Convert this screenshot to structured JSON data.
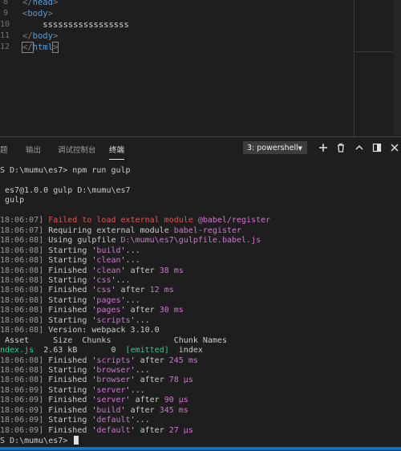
{
  "editor": {
    "lines": [
      {
        "num": "8",
        "indent": "",
        "kind": "close",
        "tag": "head"
      },
      {
        "num": "9",
        "indent": "",
        "kind": "open",
        "tag": "body"
      },
      {
        "num": "10",
        "indent": "    ",
        "kind": "text",
        "text": "sssssssssssssssss"
      },
      {
        "num": "11",
        "indent": "",
        "kind": "close",
        "tag": "body"
      },
      {
        "num": "12",
        "indent": "",
        "kind": "close-boxed",
        "tag": "html"
      }
    ]
  },
  "panel": {
    "tabs": [
      "题",
      "输出",
      "调试控制台",
      "终端"
    ],
    "active_tab": "终端",
    "terminal_select": "3: powershell"
  },
  "terminal": {
    "lines": [
      {
        "segs": [
          {
            "t": "S D:\\mumu\\es7> npm run gulp"
          }
        ]
      },
      {
        "segs": [
          {
            "t": ""
          }
        ]
      },
      {
        "segs": [
          {
            "t": " es7@1.0.0 gulp D:\\mumu\\es7"
          }
        ]
      },
      {
        "segs": [
          {
            "t": " gulp"
          }
        ]
      },
      {
        "segs": [
          {
            "t": ""
          }
        ]
      },
      {
        "segs": [
          {
            "t": "18:06:07]",
            "c": "ts"
          },
          {
            "t": " Failed to load external module ",
            "c": "red"
          },
          {
            "t": "@babel/register",
            "c": "mag"
          }
        ]
      },
      {
        "segs": [
          {
            "t": "18:06:07]",
            "c": "ts"
          },
          {
            "t": " Requiring external module "
          },
          {
            "t": "babel-register",
            "c": "mag"
          }
        ]
      },
      {
        "segs": [
          {
            "t": "18:06:08]",
            "c": "ts"
          },
          {
            "t": " Using gulpfile "
          },
          {
            "t": "D:\\mumu\\es7\\gulpfile.babel.js",
            "c": "mag"
          }
        ]
      },
      {
        "segs": [
          {
            "t": "18:06:08]",
            "c": "ts"
          },
          {
            "t": " Starting '"
          },
          {
            "t": "build",
            "c": "mag"
          },
          {
            "t": "'..."
          }
        ]
      },
      {
        "segs": [
          {
            "t": "18:06:08]",
            "c": "ts"
          },
          {
            "t": " Starting '"
          },
          {
            "t": "clean",
            "c": "mag"
          },
          {
            "t": "'..."
          }
        ]
      },
      {
        "segs": [
          {
            "t": "18:06:08]",
            "c": "ts"
          },
          {
            "t": " Finished '"
          },
          {
            "t": "clean",
            "c": "mag"
          },
          {
            "t": "' after "
          },
          {
            "t": "38 ms",
            "c": "mag"
          }
        ]
      },
      {
        "segs": [
          {
            "t": "18:06:08]",
            "c": "ts"
          },
          {
            "t": " Starting '"
          },
          {
            "t": "css",
            "c": "mag"
          },
          {
            "t": "'..."
          }
        ]
      },
      {
        "segs": [
          {
            "t": "18:06:08]",
            "c": "ts"
          },
          {
            "t": " Finished '"
          },
          {
            "t": "css",
            "c": "mag"
          },
          {
            "t": "' after "
          },
          {
            "t": "12 ms",
            "c": "mag"
          }
        ]
      },
      {
        "segs": [
          {
            "t": "18:06:08]",
            "c": "ts"
          },
          {
            "t": " Starting '"
          },
          {
            "t": "pages",
            "c": "mag"
          },
          {
            "t": "'..."
          }
        ]
      },
      {
        "segs": [
          {
            "t": "18:06:08]",
            "c": "ts"
          },
          {
            "t": " Finished '"
          },
          {
            "t": "pages",
            "c": "mag"
          },
          {
            "t": "' after "
          },
          {
            "t": "30 ms",
            "c": "mag"
          }
        ]
      },
      {
        "segs": [
          {
            "t": "18:06:08]",
            "c": "ts"
          },
          {
            "t": " Starting '"
          },
          {
            "t": "scripts",
            "c": "mag"
          },
          {
            "t": "'..."
          }
        ]
      },
      {
        "segs": [
          {
            "t": "18:06:08]",
            "c": "ts"
          },
          {
            "t": " Version: webpack 3.10.0"
          }
        ]
      },
      {
        "segs": [
          {
            "t": " Asset     Size  Chunks             Chunk Names"
          }
        ]
      },
      {
        "segs": [
          {
            "t": "ndex.js",
            "c": "grn"
          },
          {
            "t": "  2.63 kB       0  "
          },
          {
            "t": "[emitted]",
            "c": "grn"
          },
          {
            "t": "  index"
          }
        ]
      },
      {
        "segs": [
          {
            "t": "18:06:08]",
            "c": "ts"
          },
          {
            "t": " Finished '"
          },
          {
            "t": "scripts",
            "c": "mag"
          },
          {
            "t": "' after "
          },
          {
            "t": "245 ms",
            "c": "mag"
          }
        ]
      },
      {
        "segs": [
          {
            "t": "18:06:08]",
            "c": "ts"
          },
          {
            "t": " Starting '"
          },
          {
            "t": "browser",
            "c": "mag"
          },
          {
            "t": "'..."
          }
        ]
      },
      {
        "segs": [
          {
            "t": "18:06:08]",
            "c": "ts"
          },
          {
            "t": " Finished '"
          },
          {
            "t": "browser",
            "c": "mag"
          },
          {
            "t": "' after "
          },
          {
            "t": "78 μs",
            "c": "mag"
          }
        ]
      },
      {
        "segs": [
          {
            "t": "18:06:09]",
            "c": "ts"
          },
          {
            "t": " Starting '"
          },
          {
            "t": "server",
            "c": "mag"
          },
          {
            "t": "'..."
          }
        ]
      },
      {
        "segs": [
          {
            "t": "18:06:09]",
            "c": "ts"
          },
          {
            "t": " Finished '"
          },
          {
            "t": "server",
            "c": "mag"
          },
          {
            "t": "' after "
          },
          {
            "t": "90 μs",
            "c": "mag"
          }
        ]
      },
      {
        "segs": [
          {
            "t": "18:06:09]",
            "c": "ts"
          },
          {
            "t": " Finished '"
          },
          {
            "t": "build",
            "c": "mag"
          },
          {
            "t": "' after "
          },
          {
            "t": "345 ms",
            "c": "mag"
          }
        ]
      },
      {
        "segs": [
          {
            "t": "18:06:09]",
            "c": "ts"
          },
          {
            "t": " Starting '"
          },
          {
            "t": "default",
            "c": "mag"
          },
          {
            "t": "'..."
          }
        ]
      },
      {
        "segs": [
          {
            "t": "18:06:09]",
            "c": "ts"
          },
          {
            "t": " Finished '"
          },
          {
            "t": "default",
            "c": "mag"
          },
          {
            "t": "' after "
          },
          {
            "t": "27 μs",
            "c": "mag"
          }
        ]
      },
      {
        "segs": [
          {
            "t": "S D:\\mumu\\es7> "
          }
        ],
        "cursor": true
      }
    ]
  },
  "colors": {
    "background": "#1e1e1e",
    "accent": "#007acc",
    "error": "#f14c4c",
    "highlight": "#d670d6",
    "success": "#23d18b"
  }
}
